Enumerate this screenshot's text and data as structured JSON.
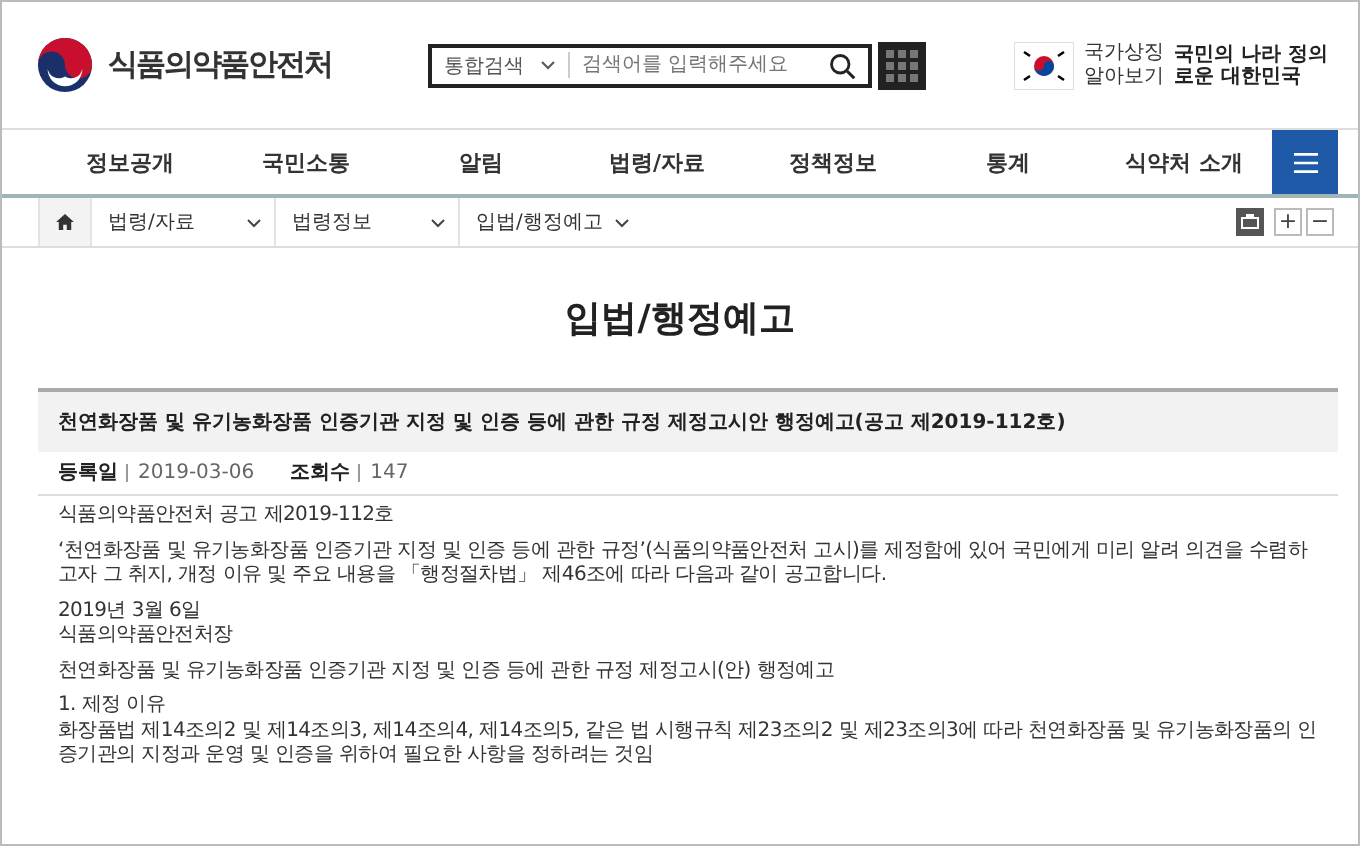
{
  "header": {
    "site_name": "식품의약품안전처",
    "search": {
      "scope": "통합검색",
      "placeholder": "검색어를 입력해주세요"
    },
    "symbol_link": "국가상징 알아보기",
    "slogan": "국민의 나라 정의로운 대한민국"
  },
  "nav": [
    "정보공개",
    "국민소통",
    "알림",
    "법령/자료",
    "정책정보",
    "통계",
    "식약처 소개"
  ],
  "breadcrumb": [
    "법령/자료",
    "법령정보",
    "입법/행정예고"
  ],
  "zoom_buttons": [
    "+",
    "−"
  ],
  "page_title": "입법/행정예고",
  "article": {
    "title": "천연화장품 및 유기농화장품 인증기관 지정 및 인증 등에 관한 규정 제정고시안 행정예고(공고 제2019-112호)",
    "meta": [
      {
        "label": "등록일",
        "value": "2019-03-06"
      },
      {
        "label": "조회수",
        "value": "147"
      }
    ],
    "paragraphs": [
      [
        "식품의약품안전처 공고 제2019-112호"
      ],
      [
        "‘천연화장품 및 유기농화장품 인증기관 지정 및 인증 등에 관한 규정’(식품의약품안전처 고시)를 제정함에 있어 국민에게 미리 알려 의견을 수렴하고자 그 취지, 개정 이유 및 주요 내용을 「행정절차법」 제46조에 따라 다음과 같이 공고합니다."
      ],
      [
        "2019년 3월 6일",
        "식품의약품안전처장"
      ],
      [
        "천연화장품 및 유기농화장품 인증기관 지정 및 인증 등에 관한 규정 제정고시(안) 행정예고"
      ],
      [
        "1. 제정 이유",
        "화장품법 제14조의2 및 제14조의3, 제14조의4, 제14조의5, 같은 법 시행규칙 제23조의2 및 제23조의3에 따라 천연화장품 및 유기농화장품의 인증기관의 지정과 운영 및 인증을 위하여 필요한 사항을 정하려는 것임"
      ]
    ]
  }
}
